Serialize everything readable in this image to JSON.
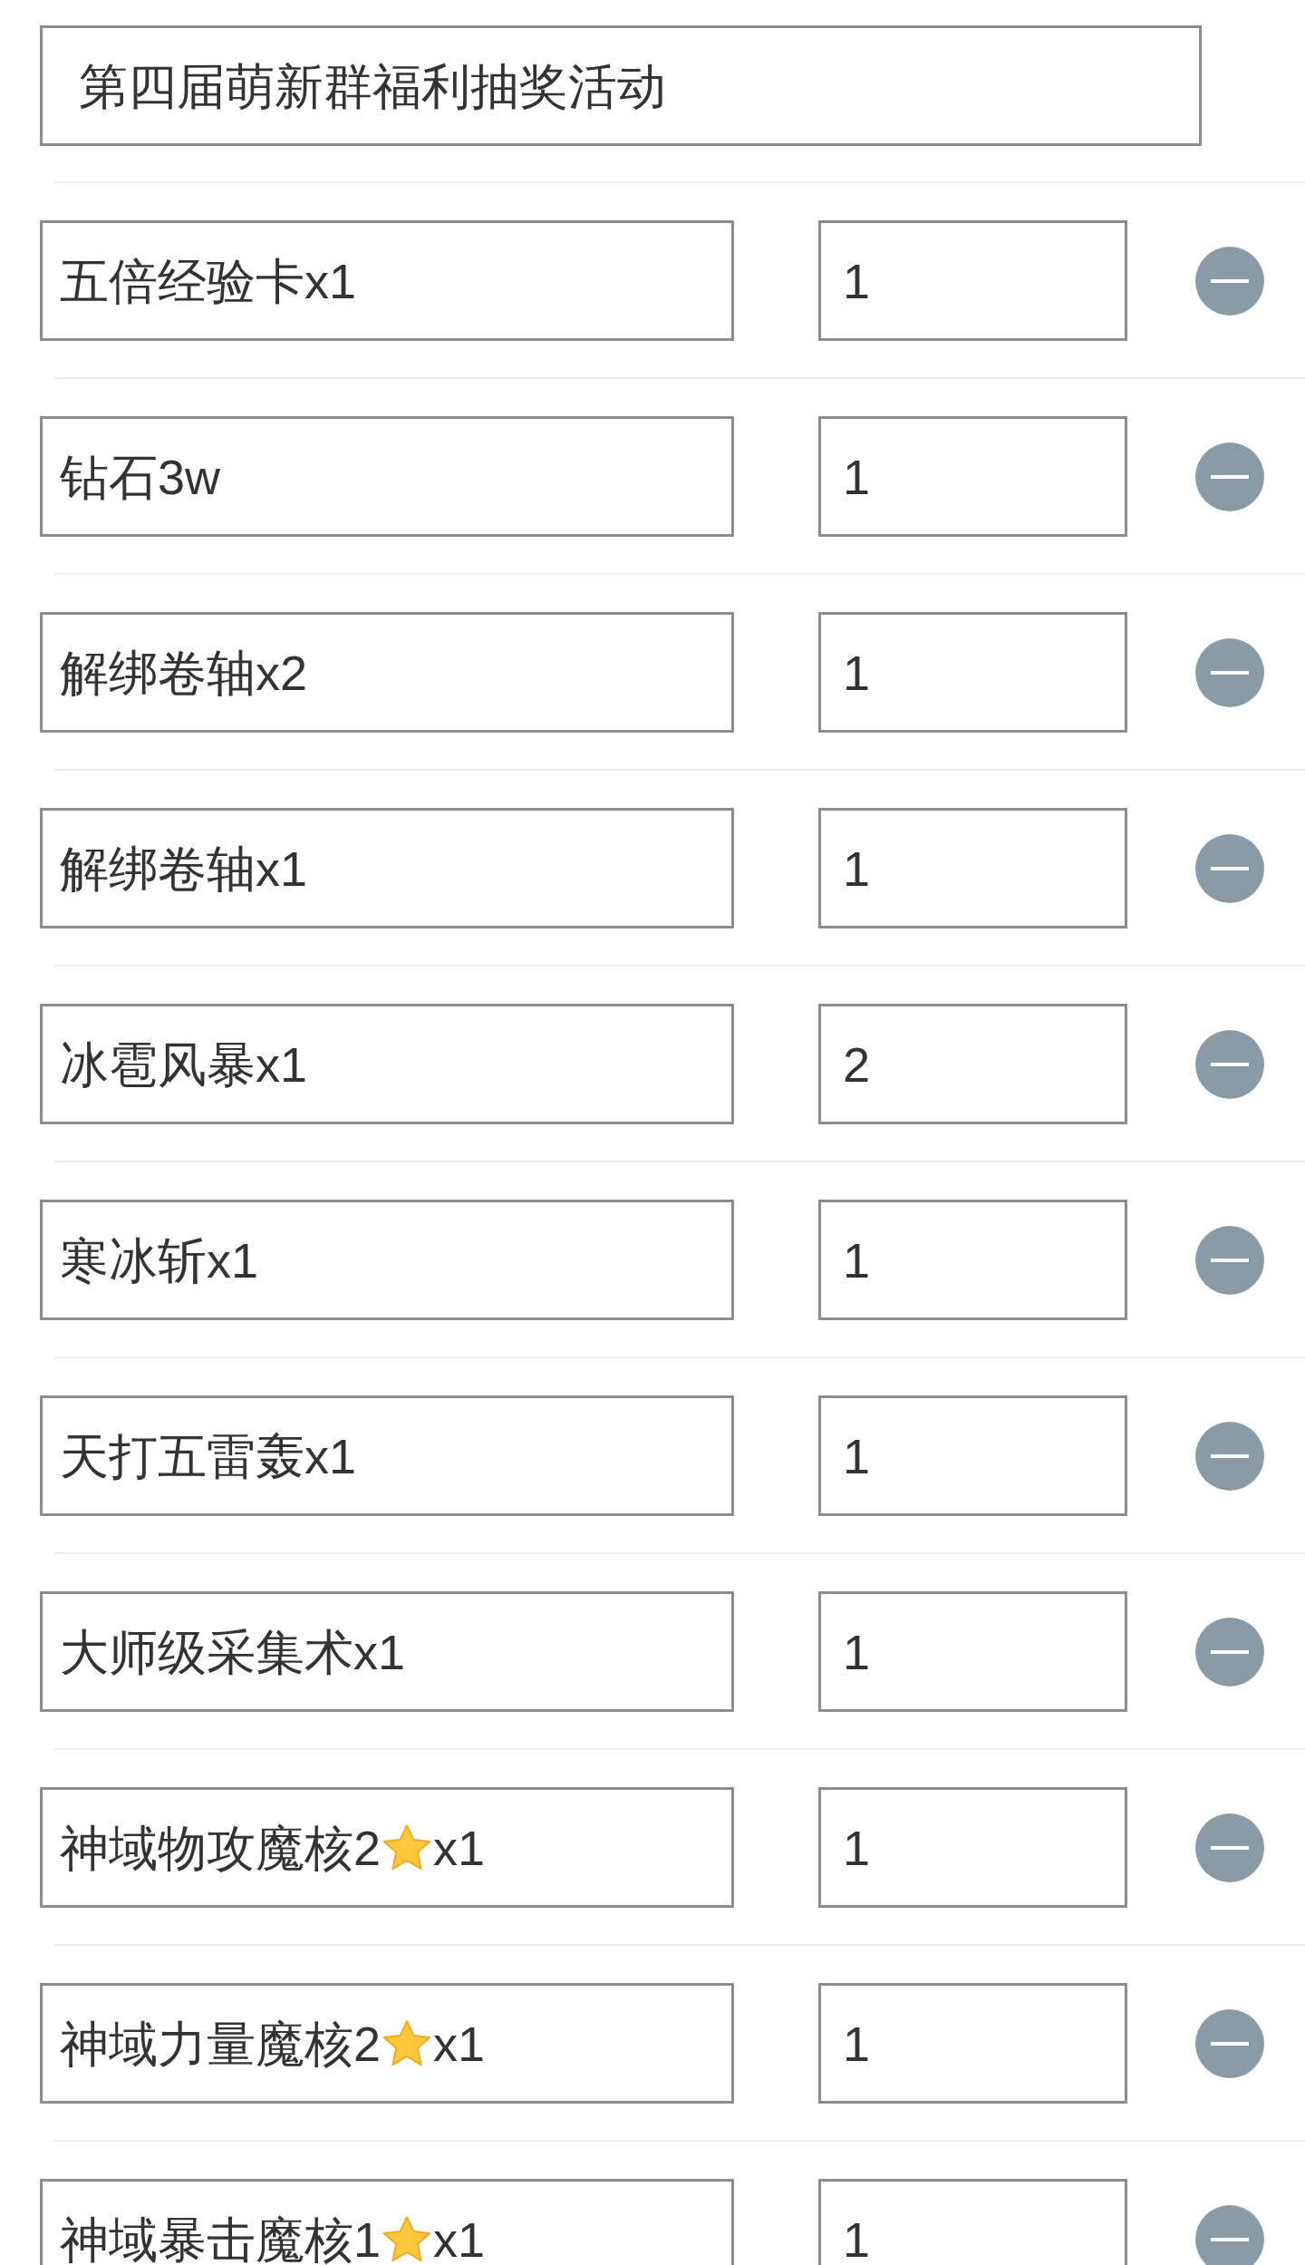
{
  "title_field": {
    "value": "第四届萌新群福利抽奖活动"
  },
  "prizes": [
    {
      "name": [
        {
          "kind": "text",
          "text": "五倍经验卡x1"
        }
      ],
      "quantity": "1"
    },
    {
      "name": [
        {
          "kind": "text",
          "text": "钻石3w"
        }
      ],
      "quantity": "1"
    },
    {
      "name": [
        {
          "kind": "text",
          "text": "解绑卷轴x2"
        }
      ],
      "quantity": "1"
    },
    {
      "name": [
        {
          "kind": "text",
          "text": "解绑卷轴x1"
        }
      ],
      "quantity": "1"
    },
    {
      "name": [
        {
          "kind": "text",
          "text": "冰雹风暴x1"
        }
      ],
      "quantity": "2"
    },
    {
      "name": [
        {
          "kind": "text",
          "text": "寒冰斩x1"
        }
      ],
      "quantity": "1"
    },
    {
      "name": [
        {
          "kind": "text",
          "text": "天打五雷轰x1"
        }
      ],
      "quantity": "1"
    },
    {
      "name": [
        {
          "kind": "text",
          "text": "大师级采集术x1"
        }
      ],
      "quantity": "1"
    },
    {
      "name": [
        {
          "kind": "text",
          "text": "神域物攻魔核2"
        },
        {
          "kind": "star"
        },
        {
          "kind": "text",
          "text": "x1"
        }
      ],
      "quantity": "1"
    },
    {
      "name": [
        {
          "kind": "text",
          "text": "神域力量魔核2"
        },
        {
          "kind": "star"
        },
        {
          "kind": "text",
          "text": "x1"
        }
      ],
      "quantity": "1"
    },
    {
      "name": [
        {
          "kind": "text",
          "text": "神域暴击魔核1"
        },
        {
          "kind": "star"
        },
        {
          "kind": "text",
          "text": "x1"
        }
      ],
      "quantity": "1"
    }
  ]
}
